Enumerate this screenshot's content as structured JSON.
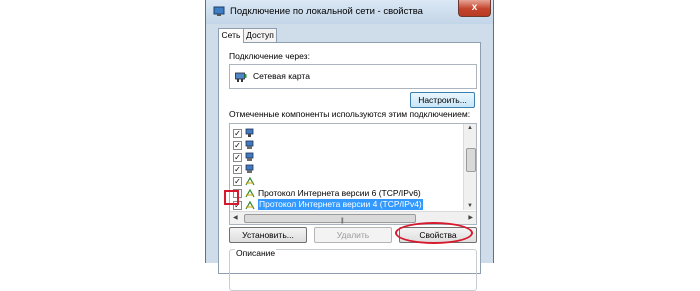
{
  "window": {
    "title": "Подключение по локальной сети - свойства",
    "close_glyph": "x"
  },
  "tabs": [
    {
      "label": "Сеть",
      "active": true
    },
    {
      "label": "Доступ",
      "active": false
    }
  ],
  "connect_using": {
    "label": "Подключение через:",
    "adapter": "Сетевая карта",
    "configure_button": "Настроить..."
  },
  "components": {
    "label": "Отмеченные компоненты используются этим подключением:",
    "items": [
      {
        "text": "",
        "checked": true,
        "icon": "network-client-icon"
      },
      {
        "text": "",
        "checked": true,
        "icon": "network-service-icon"
      },
      {
        "text": "",
        "checked": true,
        "icon": "network-service-icon"
      },
      {
        "text": "",
        "checked": true,
        "icon": "network-service-icon"
      },
      {
        "text": "",
        "checked": true,
        "icon": "protocol-icon"
      },
      {
        "text": "Протокол Интернета версии 6 (TCP/IPv6)",
        "checked": false,
        "icon": "protocol-icon"
      },
      {
        "text": "Протокол Интернета версии 4 (TCP/IPv4)",
        "checked": true,
        "icon": "protocol-icon",
        "selected": true
      }
    ]
  },
  "buttons": {
    "install": "Установить...",
    "uninstall": "Удалить",
    "properties": "Свойства"
  },
  "description": {
    "label": "Описание"
  },
  "colors": {
    "selection": "#3399ff",
    "annotation": "#d7192d"
  }
}
